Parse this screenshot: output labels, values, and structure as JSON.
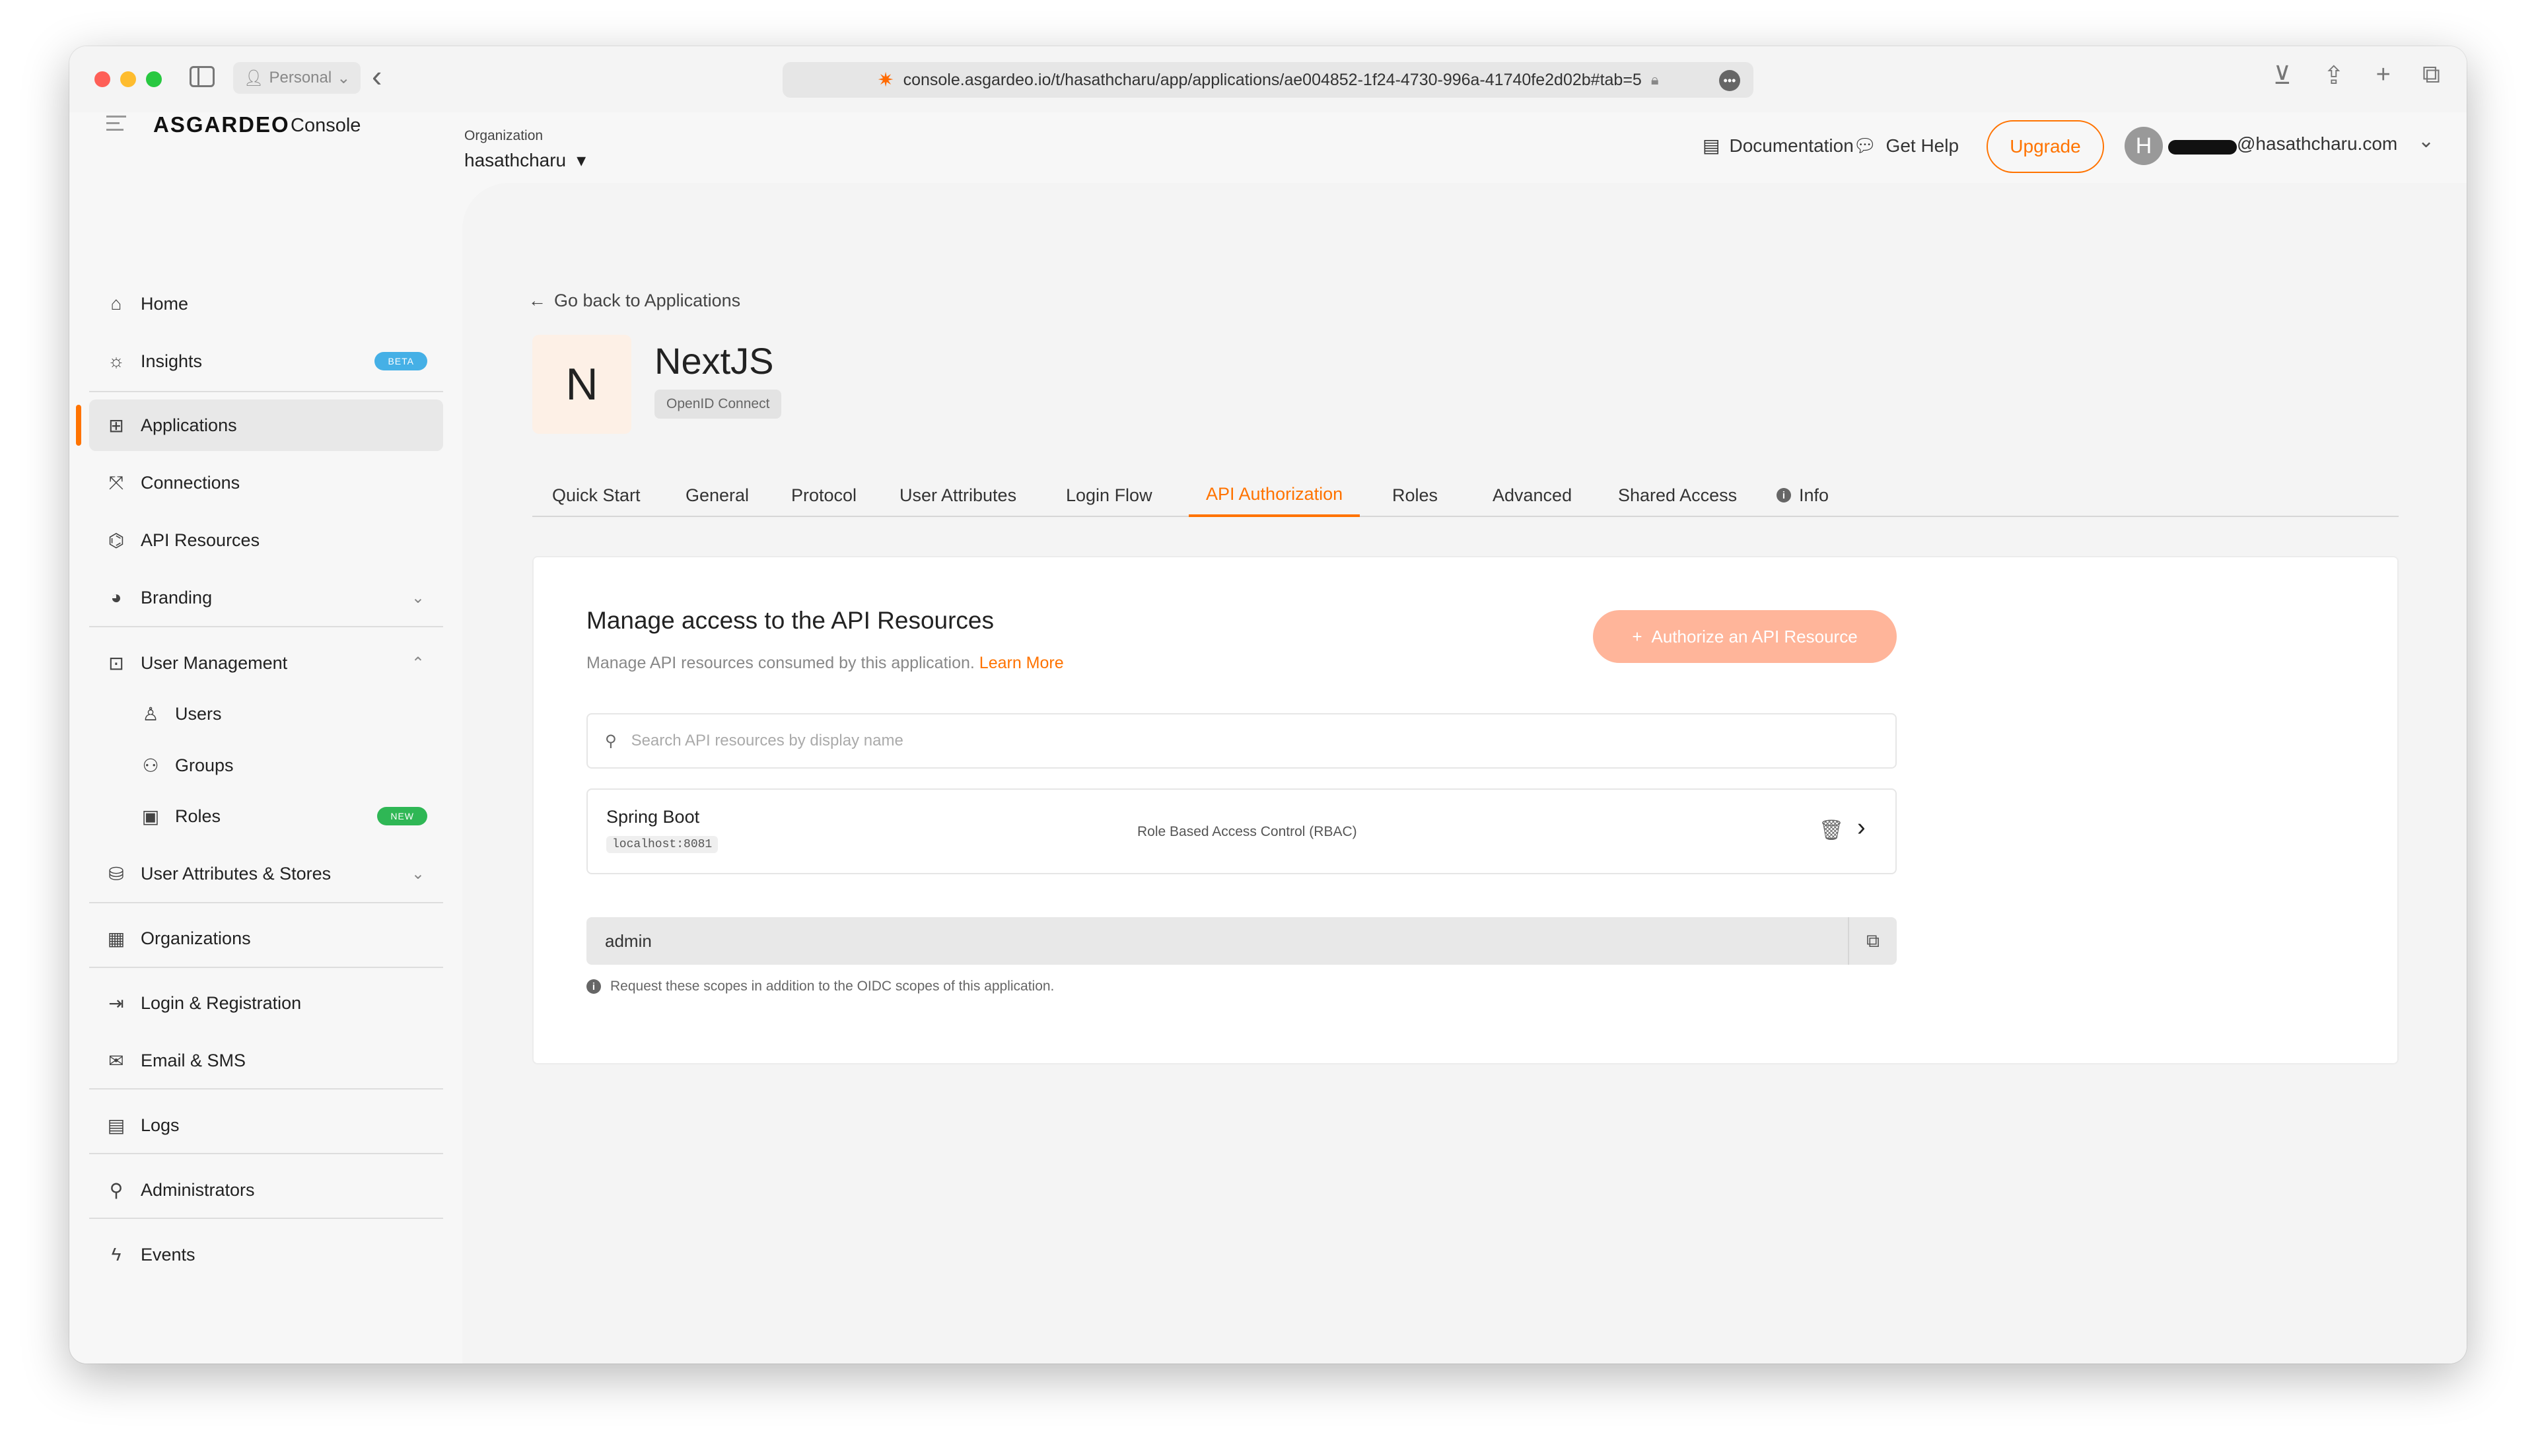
{
  "browser": {
    "profile_label": "Personal",
    "url": "console.asgardeo.io/t/hasathcharu/app/applications/ae004852-1f24-4730-996a-41740fe2d02b#tab=5"
  },
  "header": {
    "logo_text": "ASGARDEO",
    "logo_suffix": "Console",
    "org_label": "Organization",
    "org_name": "hasathcharu",
    "documentation": "Documentation",
    "get_help": "Get Help",
    "upgrade": "Upgrade",
    "avatar_initial": "H",
    "user_email": "@hasathcharu.com"
  },
  "sidebar": {
    "items": [
      {
        "label": "Home",
        "icon": "home-icon"
      },
      {
        "label": "Insights",
        "icon": "bulb-icon",
        "badge": "BETA"
      },
      {
        "label": "Applications",
        "icon": "grid-icon",
        "active": true
      },
      {
        "label": "Connections",
        "icon": "connections-icon"
      },
      {
        "label": "API Resources",
        "icon": "api-icon"
      },
      {
        "label": "Branding",
        "icon": "palette-icon"
      },
      {
        "label": "User Management",
        "icon": "user-management-icon"
      },
      {
        "label": "Users",
        "icon": "user-icon"
      },
      {
        "label": "Groups",
        "icon": "groups-icon"
      },
      {
        "label": "Roles",
        "icon": "roles-icon",
        "badge": "NEW"
      },
      {
        "label": "User Attributes & Stores",
        "icon": "attributes-icon"
      },
      {
        "label": "Organizations",
        "icon": "building-icon"
      },
      {
        "label": "Login & Registration",
        "icon": "login-icon"
      },
      {
        "label": "Email & SMS",
        "icon": "email-icon"
      },
      {
        "label": "Logs",
        "icon": "logs-icon"
      },
      {
        "label": "Administrators",
        "icon": "admin-icon"
      },
      {
        "label": "Events",
        "icon": "bolt-icon"
      }
    ]
  },
  "main": {
    "back_link": "Go back to Applications",
    "app_initial": "N",
    "app_name": "NextJS",
    "protocol_tag": "OpenID Connect",
    "tabs": [
      {
        "label": "Quick Start"
      },
      {
        "label": "General"
      },
      {
        "label": "Protocol"
      },
      {
        "label": "User Attributes"
      },
      {
        "label": "Login Flow"
      },
      {
        "label": "API Authorization",
        "active": true
      },
      {
        "label": "Roles"
      },
      {
        "label": "Advanced"
      },
      {
        "label": "Shared Access"
      },
      {
        "label": "Info"
      }
    ],
    "card": {
      "title": "Manage access to the API Resources",
      "subtitle": "Manage API resources consumed by this application.",
      "learn_more": "Learn More",
      "authorize_button": "Authorize an API Resource",
      "search_placeholder": "Search API resources by display name",
      "resource": {
        "name": "Spring Boot",
        "identifier": "localhost:8081",
        "policy": "Role Based Access Control (RBAC)"
      },
      "scope_value": "admin",
      "scope_hint": "Request these scopes in addition to the OIDC scopes of this application."
    }
  },
  "colors": {
    "accent": "#ff7300",
    "beta_badge": "#45b0e6",
    "new_badge": "#2fb755"
  }
}
